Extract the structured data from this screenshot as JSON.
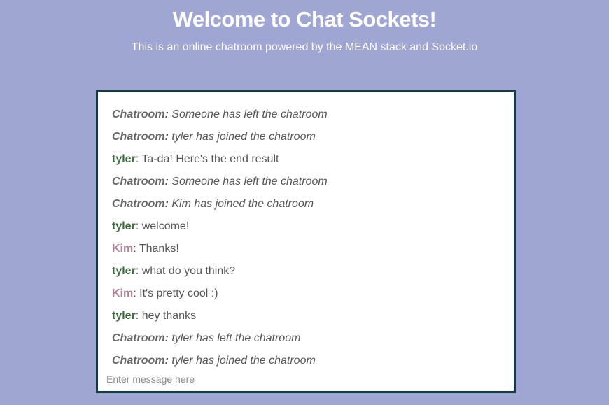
{
  "header": {
    "title": "Welcome to Chat Sockets!",
    "subtitle": "This is an online chatroom powered by the MEAN stack and Socket.io"
  },
  "colors": {
    "background": "#a0a6d3",
    "border": "#0f3b43",
    "system_author": "#666666",
    "tyler": "#3a6b3a",
    "kim": "#b4839a",
    "text": "#555555"
  },
  "messages": [
    {
      "author": "Chatroom",
      "separator": ": ",
      "text": "Someone has left the chatroom",
      "type": "system"
    },
    {
      "author": "Chatroom",
      "separator": ": ",
      "text": "tyler has joined the chatroom",
      "type": "system"
    },
    {
      "author": "tyler",
      "separator": ": ",
      "text": "Ta-da! Here's the end result",
      "type": "tyler"
    },
    {
      "author": "Chatroom",
      "separator": ": ",
      "text": "Someone has left the chatroom",
      "type": "system"
    },
    {
      "author": "Chatroom",
      "separator": ": ",
      "text": "Kim has joined the chatroom",
      "type": "system"
    },
    {
      "author": "tyler",
      "separator": ": ",
      "text": "welcome!",
      "type": "tyler"
    },
    {
      "author": "Kim",
      "separator": ": ",
      "text": "Thanks!",
      "type": "kim"
    },
    {
      "author": "tyler",
      "separator": ": ",
      "text": "what do you think?",
      "type": "tyler"
    },
    {
      "author": "Kim",
      "separator": ": ",
      "text": "It's pretty cool :)",
      "type": "kim"
    },
    {
      "author": "tyler",
      "separator": ": ",
      "text": "hey thanks",
      "type": "tyler"
    },
    {
      "author": "Chatroom",
      "separator": ": ",
      "text": "tyler has left the chatroom",
      "type": "system"
    },
    {
      "author": "Chatroom",
      "separator": ": ",
      "text": "tyler has joined the chatroom",
      "type": "system"
    }
  ],
  "input": {
    "placeholder": "Enter message here",
    "value": ""
  }
}
